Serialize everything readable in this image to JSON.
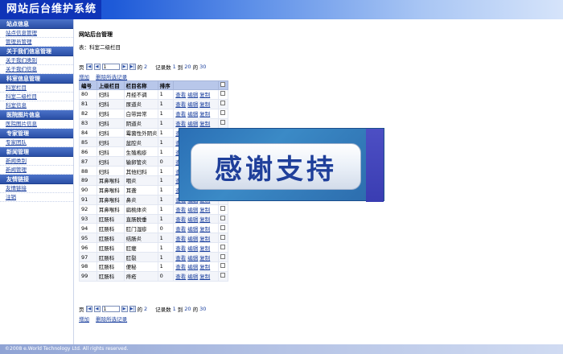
{
  "header": {
    "title": "网站后台维护系统"
  },
  "sidebar": {
    "sections": [
      {
        "title": "站点信息",
        "items": [
          "站点信息管理",
          "管理员管理"
        ]
      },
      {
        "title": "关于我们信息管理",
        "items": [
          "关于我们类别",
          "关于我们信息"
        ]
      },
      {
        "title": "科室信息管理",
        "items": [
          "科室栏目",
          "科室二级栏目",
          "科室信息"
        ]
      },
      {
        "title": "医院图片信息",
        "items": [
          "医院图片信息"
        ]
      },
      {
        "title": "专家管理",
        "items": [
          "专家团队"
        ]
      },
      {
        "title": "新闻管理",
        "items": [
          "新闻类别",
          "新闻管理"
        ]
      },
      {
        "title": "友情链接",
        "items": [
          "友情链接",
          "注销"
        ]
      }
    ]
  },
  "main": {
    "page_title": "网站后台管理",
    "table_caption": "表：科室二级栏目",
    "pager": {
      "page_label": "页",
      "first": "|◀",
      "prev": "◀",
      "next": "▶",
      "last": "▶|",
      "current_page": "1",
      "of_label": "的",
      "total_pages": "2",
      "records_label": "记录数",
      "from": "1",
      "to_label": "到",
      "to": "20",
      "of_label2": "的",
      "total": "30"
    },
    "actions": {
      "add": "增加",
      "delete_selected": "删除所选记录"
    },
    "columns": [
      "编号",
      "上级栏目",
      "栏目名称",
      "排序",
      "",
      ""
    ],
    "ops": {
      "view": "查看",
      "edit": "编辑",
      "copy": "复制"
    },
    "rows": [
      [
        "80",
        "妇科",
        "月经不调",
        "1"
      ],
      [
        "81",
        "妇科",
        "尿道炎",
        "1"
      ],
      [
        "82",
        "妇科",
        "白带异常",
        "1"
      ],
      [
        "83",
        "妇科",
        "阴道炎",
        "1"
      ],
      [
        "84",
        "妇科",
        "霉菌性外阴炎",
        "1"
      ],
      [
        "85",
        "妇科",
        "盆腔炎",
        "1"
      ],
      [
        "86",
        "妇科",
        "生殖疱疹",
        "1"
      ],
      [
        "87",
        "妇科",
        "输卵管炎",
        "0"
      ],
      [
        "88",
        "妇科",
        "其他妇科",
        "1"
      ],
      [
        "89",
        "耳鼻喉科",
        "咽炎",
        "1"
      ],
      [
        "90",
        "耳鼻喉科",
        "耳聋",
        "1"
      ],
      [
        "91",
        "耳鼻喉科",
        "鼻炎",
        "1"
      ],
      [
        "92",
        "耳鼻喉科",
        "扁桃体炎",
        "1"
      ],
      [
        "93",
        "肛肠科",
        "直肠脱垂",
        "1"
      ],
      [
        "94",
        "肛肠科",
        "肛门湿疹",
        "0"
      ],
      [
        "95",
        "肛肠科",
        "结肠炎",
        "1"
      ],
      [
        "96",
        "肛肠科",
        "肛瘘",
        "1"
      ],
      [
        "97",
        "肛肠科",
        "肛裂",
        "1"
      ],
      [
        "98",
        "肛肠科",
        "便秘",
        "1"
      ],
      [
        "99",
        "肛肠科",
        "痔疮",
        "0"
      ]
    ]
  },
  "overlay": {
    "text": "感谢支持"
  },
  "footer": {
    "text": "©2008 e.World Technology Ltd. All rights reserved."
  }
}
